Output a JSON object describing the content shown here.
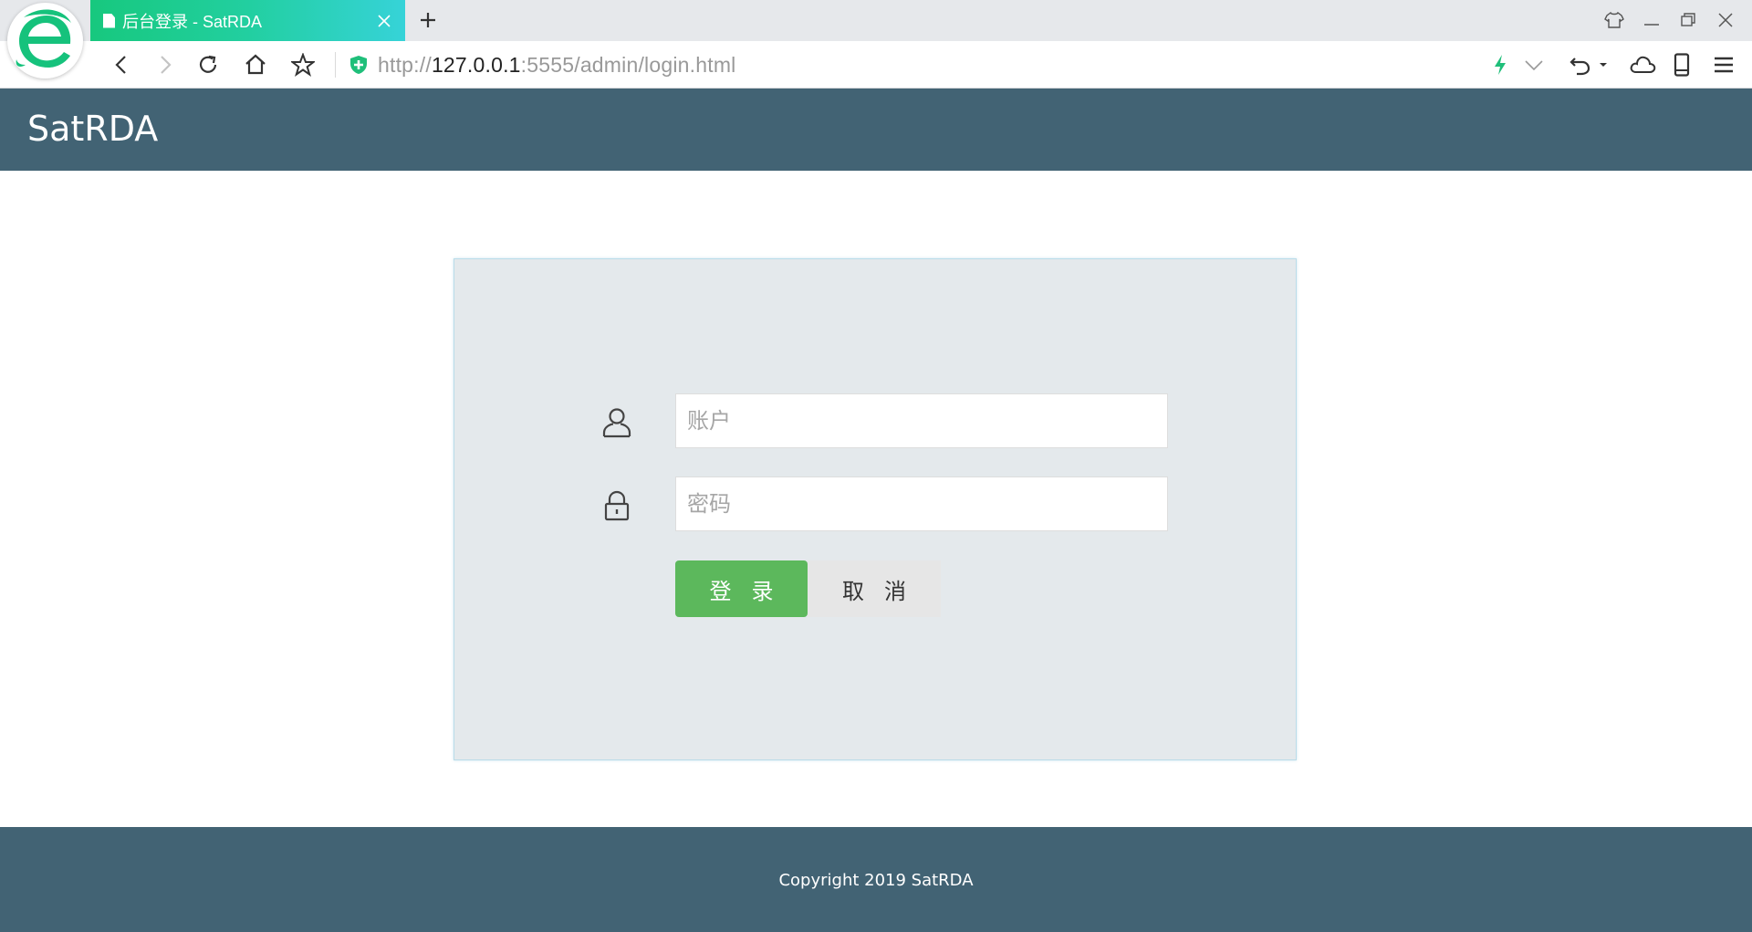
{
  "browser": {
    "tab": {
      "title": "后台登录 - SatRDA"
    },
    "address": {
      "scheme": "http://",
      "host": "127.0.0.1",
      "rest": ":5555/admin/login.html"
    },
    "icons": {
      "logo": "browser-e-logo",
      "back": "arrow-left-icon",
      "forward": "arrow-right-icon",
      "reload": "reload-icon",
      "home": "home-icon",
      "bookmark": "star-icon",
      "security": "shield-icon"
    }
  },
  "header": {
    "title": "SatRDA"
  },
  "login": {
    "account_placeholder": "账户",
    "password_placeholder": "密码",
    "login_label": "登录",
    "cancel_label": "取消"
  },
  "footer": {
    "copyright": "Copyright 2019 SatRDA"
  },
  "colors": {
    "header_bg": "#426374",
    "panel_bg": "#e4e9ec",
    "login_button": "#5cb85c",
    "cancel_button": "#e6e6e6",
    "tab_gradient_start": "#17c87e",
    "tab_gradient_end": "#36d3d8"
  }
}
